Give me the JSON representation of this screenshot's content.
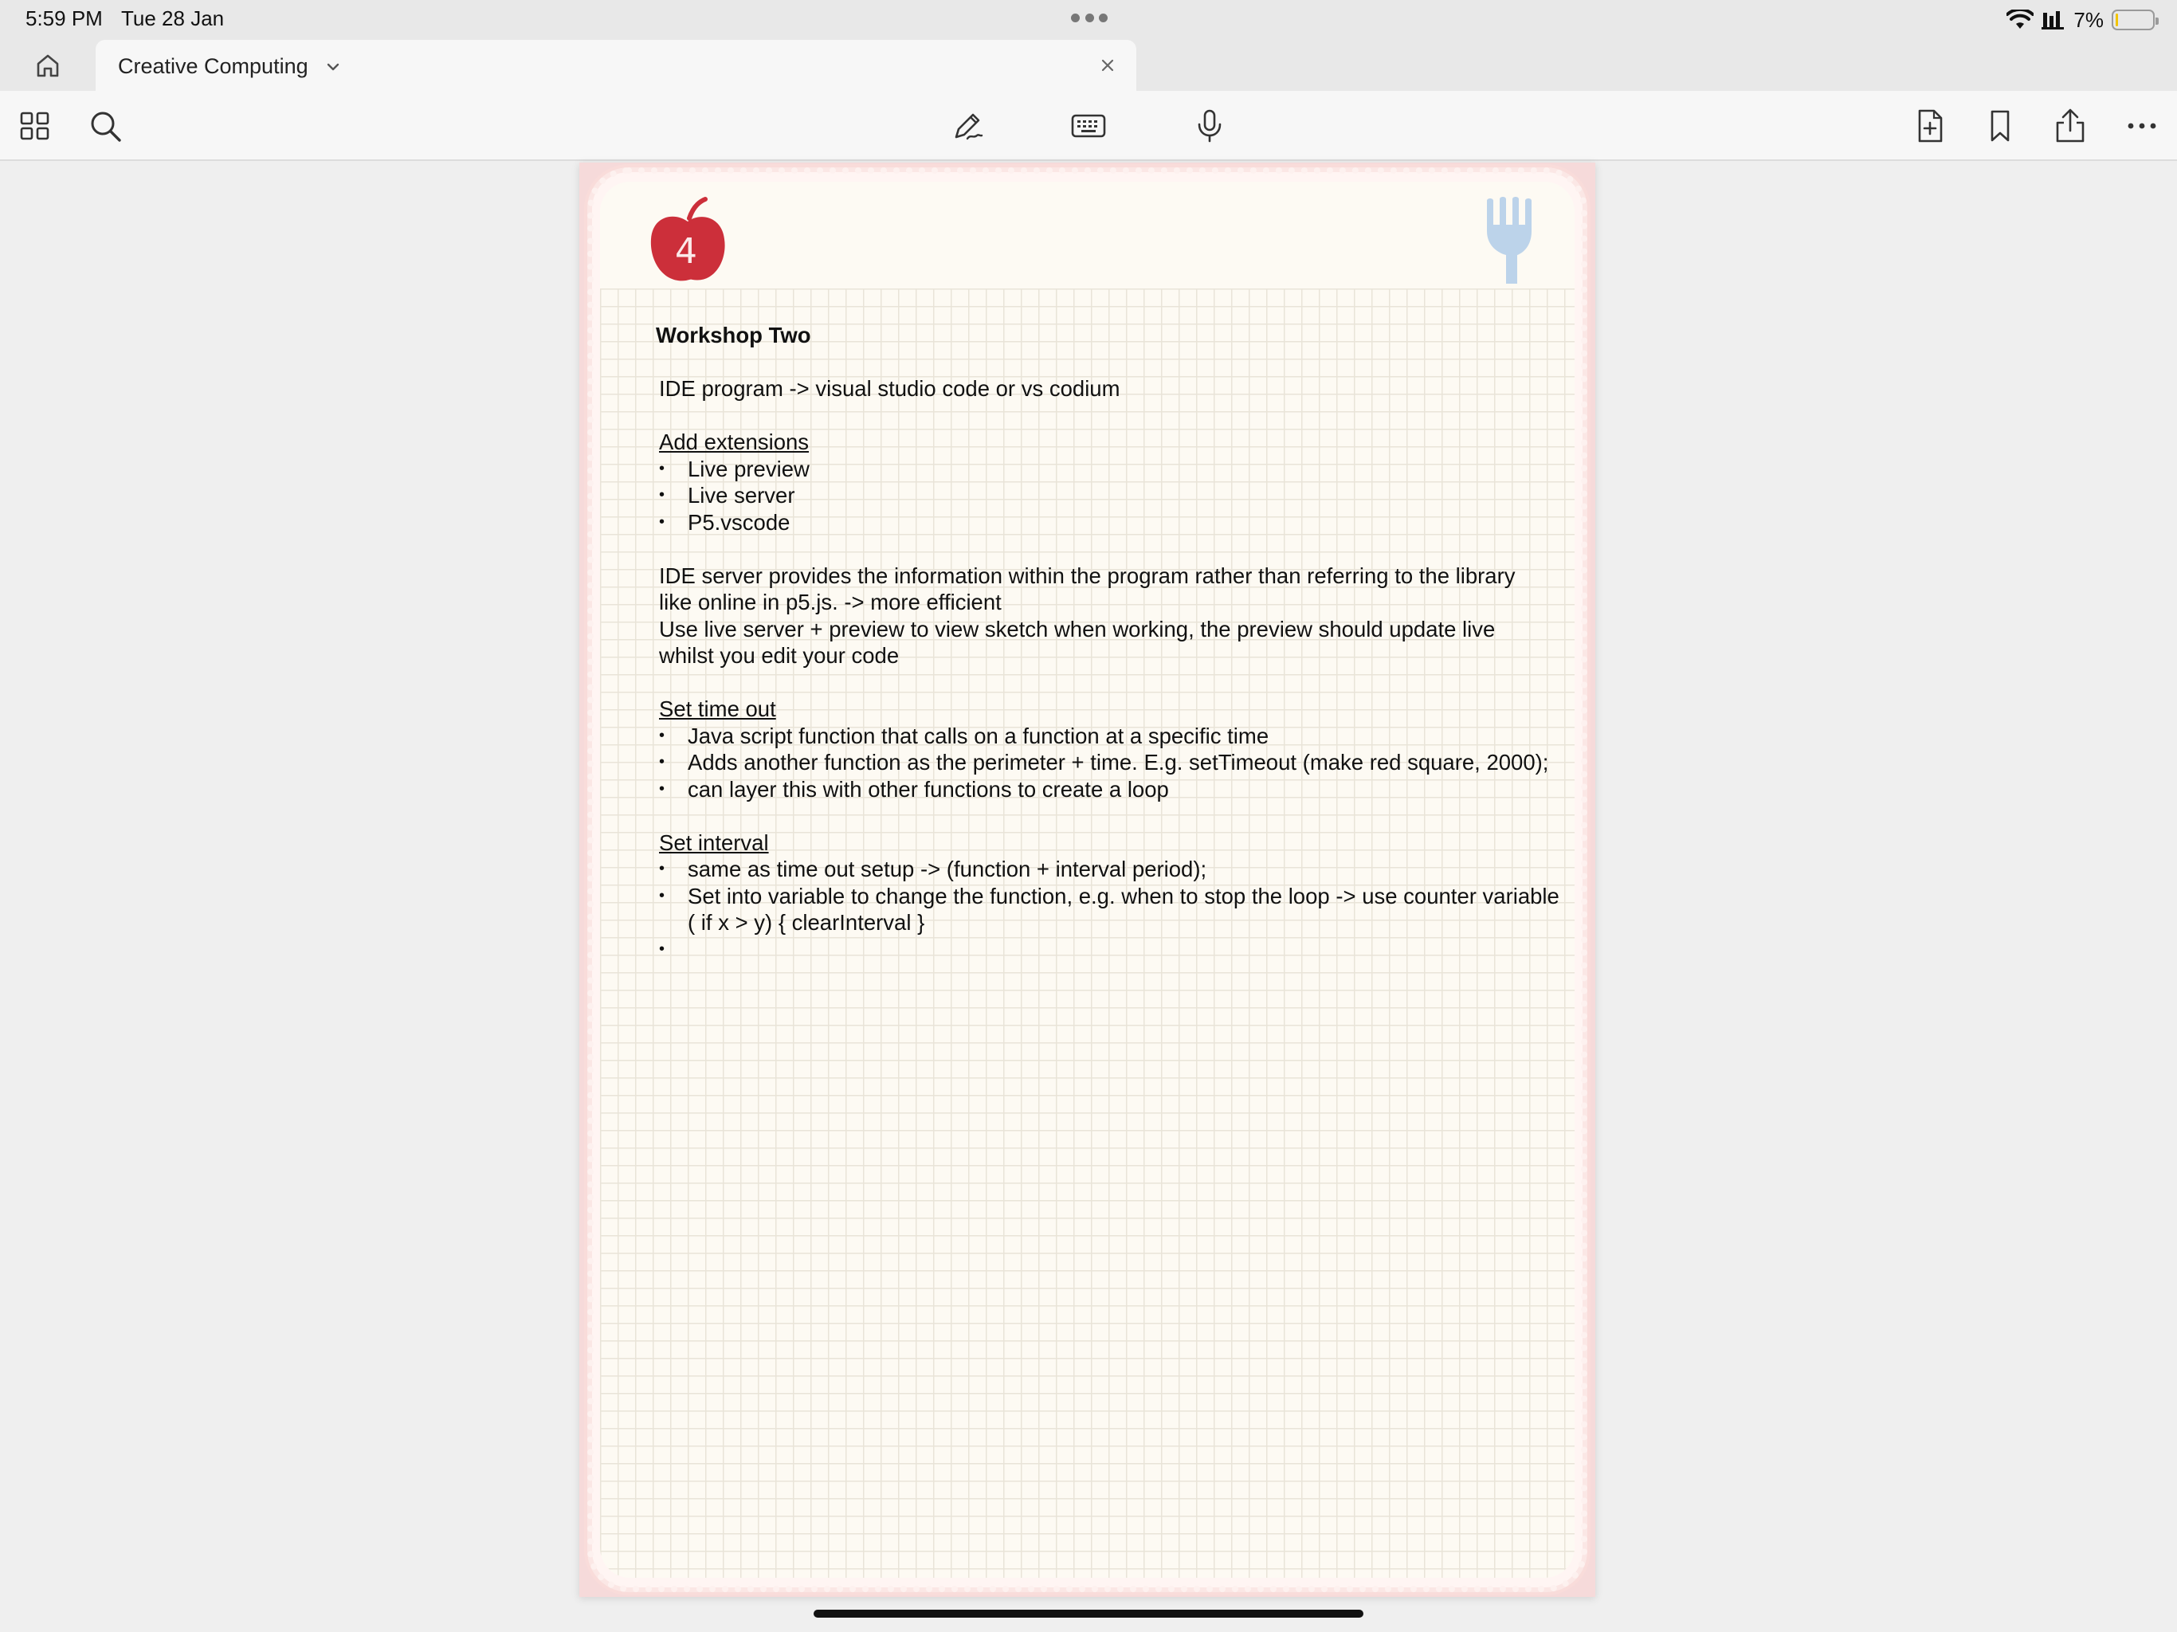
{
  "status_bar": {
    "time": "5:59 PM",
    "date": "Tue 28 Jan",
    "battery_percent": "7%",
    "battery_level": 0.07,
    "battery_color": "#f2c400"
  },
  "tab": {
    "title": "Creative Computing"
  },
  "toolbar": {
    "left_icons": [
      "grid-icon",
      "search-icon"
    ],
    "center_icons": [
      "pen-icon",
      "keyboard-icon",
      "microphone-icon"
    ],
    "right_icons": [
      "add-page-icon",
      "bookmark-icon",
      "share-icon",
      "more-icon"
    ]
  },
  "page": {
    "sticker_number": "4",
    "title": "Workshop Two",
    "ide_line": "IDE program -> visual studio code or vs codium",
    "extensions": {
      "heading": "Add extensions",
      "items": [
        "Live preview",
        "Live server",
        "P5.vscode"
      ]
    },
    "server_para": [
      "IDE server provides the information within the program rather than referring to the library",
      "like online in p5.js. -> more efficient",
      "Use live server + preview to view sketch when working, the preview should update live",
      "whilst you edit your code"
    ],
    "timeout": {
      "heading": "Set time out",
      "items": [
        "Java script function that calls on a function at a specific time",
        "Adds another function as the perimeter + time. E.g. setTimeout (make red square, 2000);",
        "can layer this with other functions to create a loop"
      ]
    },
    "interval": {
      "heading": "Set interval",
      "items": [
        "same as time out setup -> (function + interval period);",
        "Set into variable to change the function, e.g. when to stop the loop -> use counter variable ( if x > y) { clearInterval }"
      ]
    },
    "accent_colors": {
      "border_pink": "#f6dada",
      "apple_red": "#cc2f3a",
      "fork_blue": "#bcd3ea"
    }
  }
}
